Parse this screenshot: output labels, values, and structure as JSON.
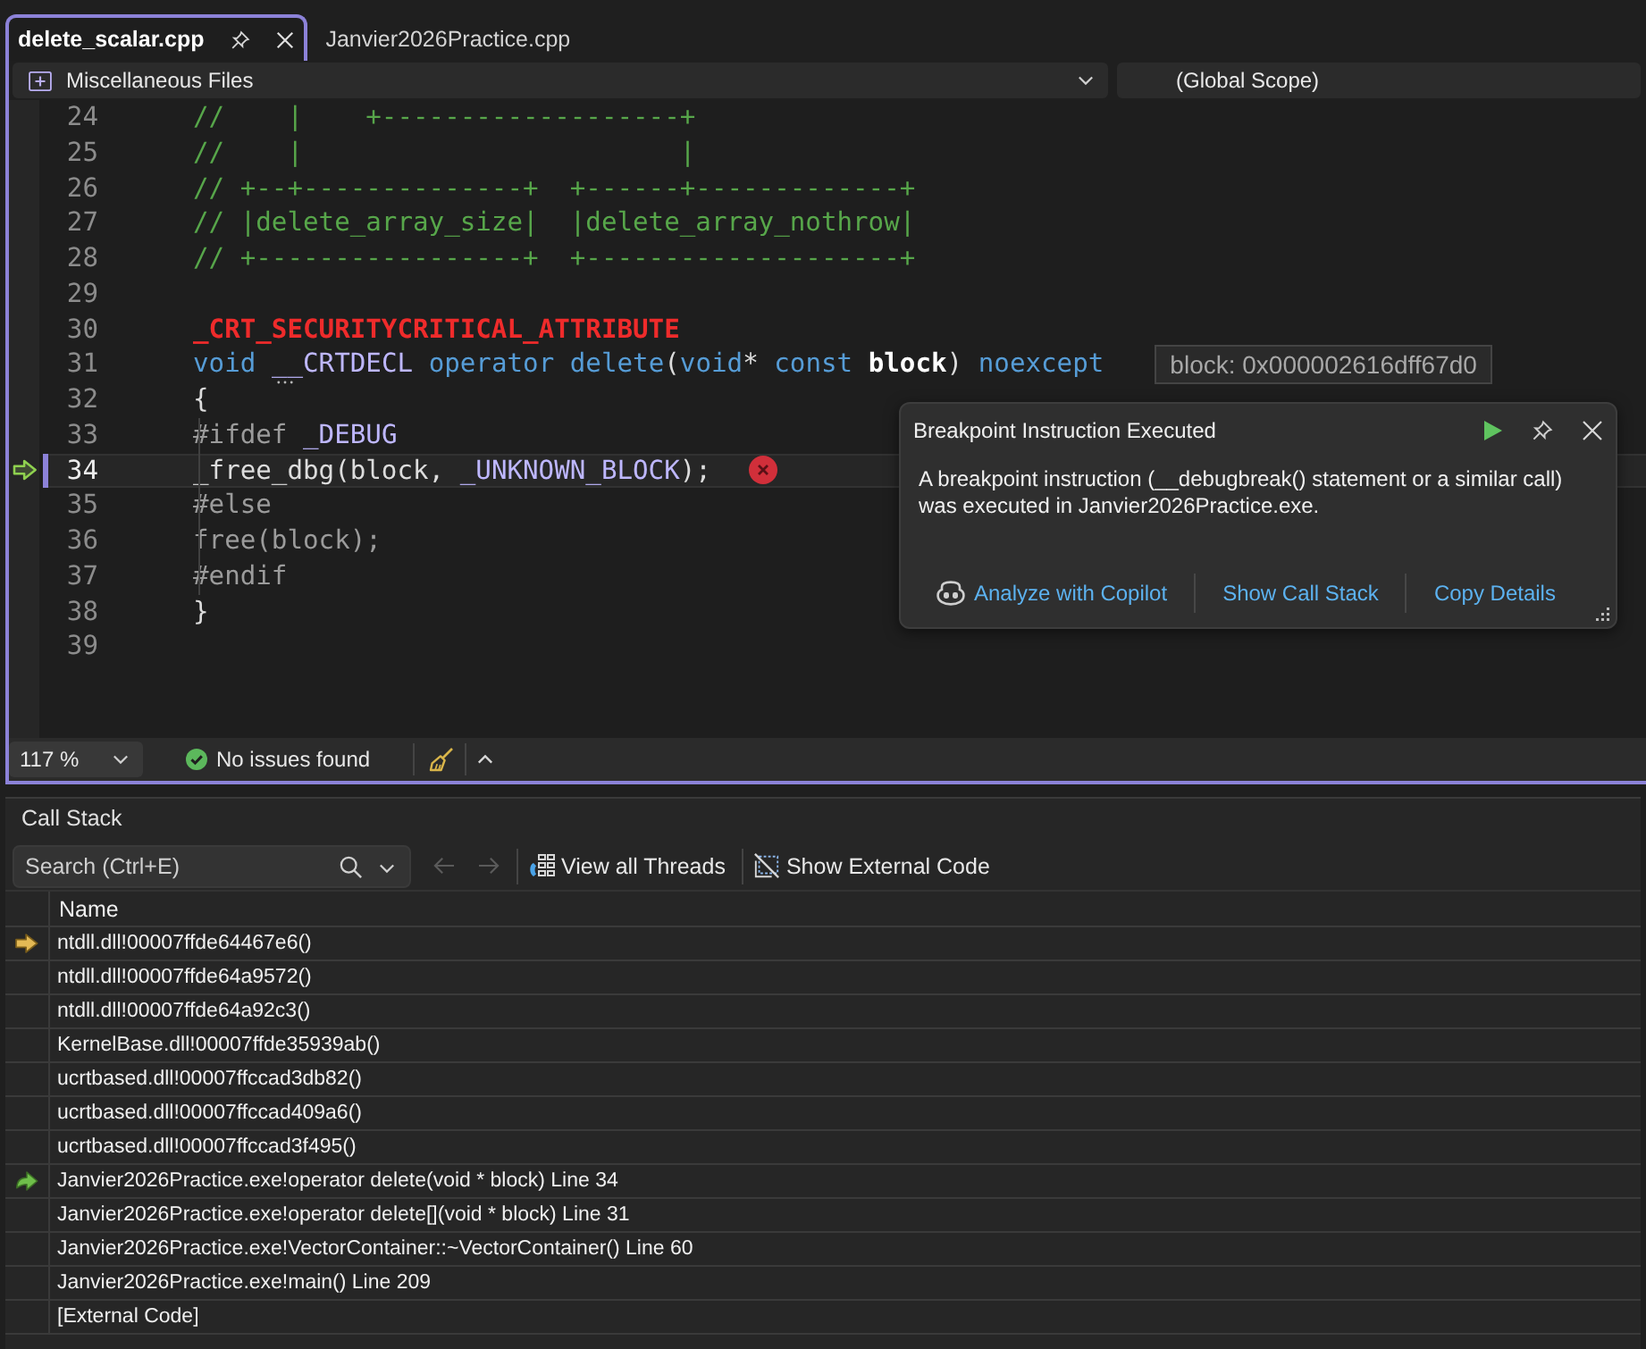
{
  "tabs": [
    {
      "label": "delete_scalar.cpp",
      "selected": true
    },
    {
      "label": "Janvier2026Practice.cpp",
      "selected": false
    }
  ],
  "navigation": {
    "project": "Miscellaneous Files",
    "scope": "(Global Scope)"
  },
  "editor": {
    "lines": [
      {
        "number": "24",
        "current": false,
        "error": false,
        "tokens": [
          {
            "text": "//    |    +-------------------+",
            "kind": "comment"
          }
        ]
      },
      {
        "number": "25",
        "current": false,
        "error": false,
        "tokens": [
          {
            "text": "//    |                        |",
            "kind": "comment"
          }
        ]
      },
      {
        "number": "26",
        "current": false,
        "error": false,
        "tokens": [
          {
            "text": "// +--+--------------+  +------+-------------+",
            "kind": "comment"
          }
        ]
      },
      {
        "number": "27",
        "current": false,
        "error": false,
        "tokens": [
          {
            "text": "// |delete_array_size|  |delete_array_nothrow|",
            "kind": "comment"
          }
        ]
      },
      {
        "number": "28",
        "current": false,
        "error": false,
        "tokens": [
          {
            "text": "// +-----------------+  +--------------------+",
            "kind": "comment"
          }
        ]
      },
      {
        "number": "29",
        "current": false,
        "error": false
      },
      {
        "number": "30",
        "current": false,
        "error": false,
        "tokens": [
          {
            "text": "_CRT_SECURITYCRITICAL_ATTRIBUTE",
            "kind": "attribute"
          }
        ]
      },
      {
        "number": "31",
        "current": false,
        "error": false,
        "tokens": [
          {
            "text": "void ",
            "kind": "keyword"
          },
          {
            "text": "__",
            "kind": "macro",
            "suggestion": true
          },
          {
            "text": "CRTDECL ",
            "kind": "macro"
          },
          {
            "text": "operator delete",
            "kind": "keyword"
          },
          {
            "text": "(",
            "kind": "plain"
          },
          {
            "text": "void",
            "kind": "keyword"
          },
          {
            "text": "* ",
            "kind": "plain"
          },
          {
            "text": "const ",
            "kind": "keyword"
          },
          {
            "text": "block",
            "kind": "param"
          },
          {
            "text": ") ",
            "kind": "plain"
          },
          {
            "text": "noexcept",
            "kind": "keyword"
          }
        ],
        "datatip": "block: 0x000002616dff67d0"
      },
      {
        "number": "32",
        "current": false,
        "error": false,
        "tokens": [
          {
            "text": "{",
            "kind": "plain"
          }
        ]
      },
      {
        "number": "33",
        "current": false,
        "error": false,
        "tokens": [
          {
            "text": "    #ifdef ",
            "kind": "preprocessor"
          },
          {
            "text": "_DEBUG",
            "kind": "macro"
          }
        ]
      },
      {
        "number": "34",
        "current": true,
        "error": true,
        "tokens": [
          {
            "text": "    _free_dbg(block, ",
            "kind": "plain"
          },
          {
            "text": "_UNKNOWN_BLOCK",
            "kind": "macro"
          },
          {
            "text": ");",
            "kind": "plain"
          }
        ]
      },
      {
        "number": "35",
        "current": false,
        "error": false,
        "tokens": [
          {
            "text": "    #else",
            "kind": "preprocessor"
          }
        ]
      },
      {
        "number": "36",
        "current": false,
        "error": false,
        "tokens": [
          {
            "text": "    free(block);",
            "kind": "inactive"
          }
        ]
      },
      {
        "number": "37",
        "current": false,
        "error": false,
        "tokens": [
          {
            "text": "    #endif",
            "kind": "preprocessor"
          }
        ]
      },
      {
        "number": "38",
        "current": false,
        "error": false,
        "tokens": [
          {
            "text": "}",
            "kind": "plain"
          }
        ]
      },
      {
        "number": "39",
        "current": false,
        "error": false
      }
    ]
  },
  "exception_popup": {
    "title": "Breakpoint Instruction Executed",
    "message": "A breakpoint instruction (__debugbreak() statement or a similar call) was executed in Janvier2026Practice.exe.",
    "links": [
      {
        "label": "Analyze with Copilot",
        "kind": "copilot"
      },
      {
        "label": "Show Call Stack",
        "kind": "plain"
      },
      {
        "label": "Copy Details",
        "kind": "plain"
      }
    ]
  },
  "editor_status": {
    "zoom": "117 %",
    "issues": "No issues found"
  },
  "call_stack": {
    "title": "Call Stack",
    "search": {
      "placeholder": "Search (Ctrl+E)"
    },
    "nav": [
      {
        "kind": "back",
        "disabled": true
      },
      {
        "kind": "forward",
        "disabled": true
      }
    ],
    "toolbar": [
      {
        "label": "View all Threads",
        "kind": "threads"
      },
      {
        "label": "Show External Code",
        "kind": "external"
      }
    ],
    "columns": [
      "Name"
    ],
    "rows": [
      {
        "name": "ntdll.dll!00007ffde64467e6()",
        "current": true,
        "selected": false
      },
      {
        "name": "ntdll.dll!00007ffde64a9572()",
        "current": false,
        "selected": false
      },
      {
        "name": "ntdll.dll!00007ffde64a92c3()",
        "current": false,
        "selected": false
      },
      {
        "name": "KernelBase.dll!00007ffde35939ab()",
        "current": false,
        "selected": false
      },
      {
        "name": "ucrtbased.dll!00007ffccad3db82()",
        "current": false,
        "selected": false
      },
      {
        "name": "ucrtbased.dll!00007ffccad409a6()",
        "current": false,
        "selected": false
      },
      {
        "name": "ucrtbased.dll!00007ffccad3f495()",
        "current": false,
        "selected": false
      },
      {
        "name": "Janvier2026Practice.exe!operator delete(void * block) Line 34",
        "current": false,
        "selected": true
      },
      {
        "name": "Janvier2026Practice.exe!operator delete[](void * block) Line 31",
        "current": false,
        "selected": false
      },
      {
        "name": "Janvier2026Practice.exe!VectorContainer::~VectorContainer() Line 60",
        "current": false,
        "selected": false
      },
      {
        "name": "Janvier2026Practice.exe!main() Line 209",
        "current": false,
        "selected": false
      },
      {
        "name": "[External Code]",
        "current": false,
        "selected": false
      }
    ]
  }
}
